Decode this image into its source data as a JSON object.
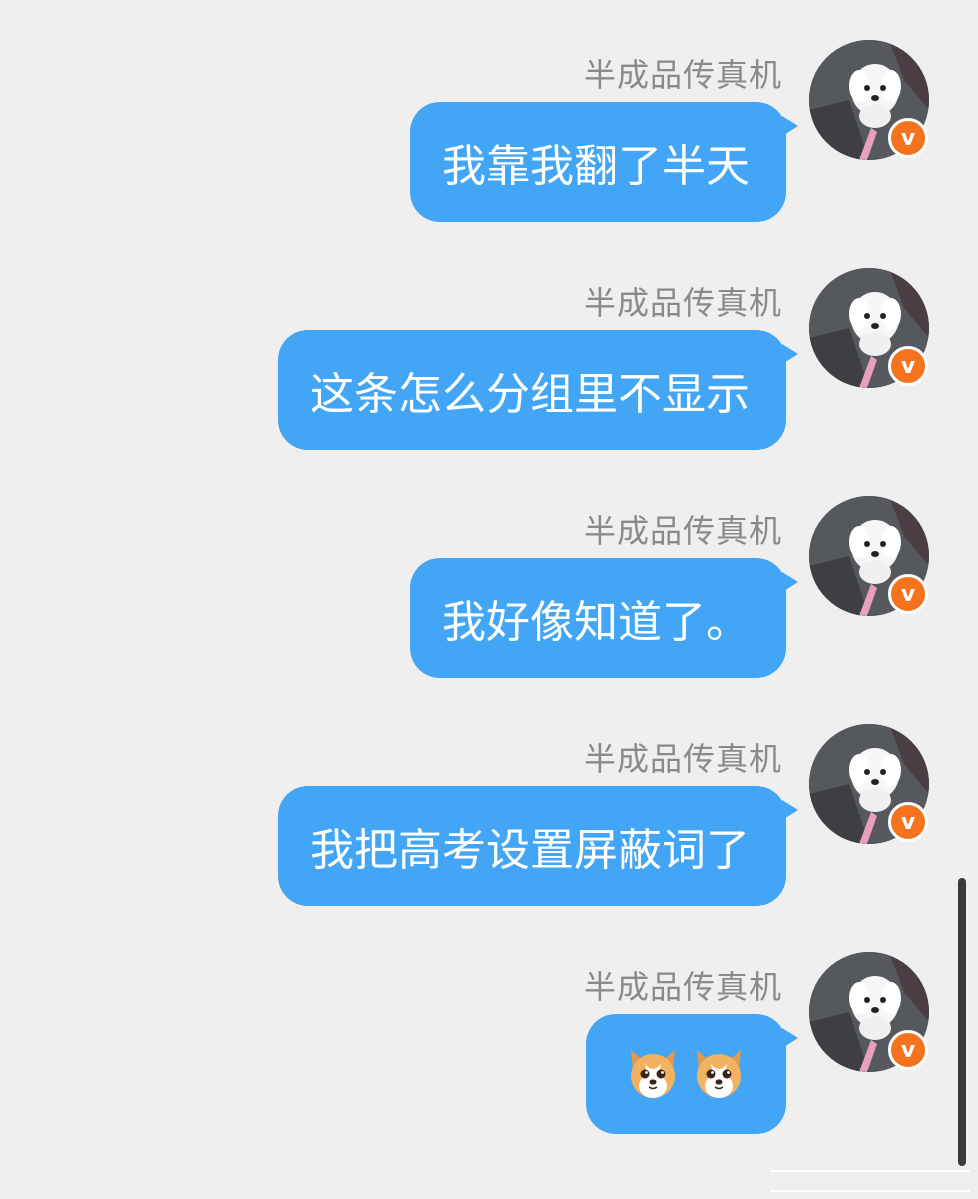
{
  "messages": [
    {
      "sender": "半成品传真机",
      "text": "我靠我翻了半天",
      "badge": "v"
    },
    {
      "sender": "半成品传真机",
      "text": "这条怎么分组里不显示",
      "badge": "v"
    },
    {
      "sender": "半成品传真机",
      "text": "我好像知道了。",
      "badge": "v"
    },
    {
      "sender": "半成品传真机",
      "text": "我把高考设置屏蔽词了",
      "badge": "v"
    },
    {
      "sender": "半成品传真机",
      "emoji": [
        "dog-face-emoji",
        "dog-face-emoji"
      ],
      "badge": "v"
    }
  ],
  "colors": {
    "background": "#efefef",
    "bubble": "#42a5f5",
    "sender_text": "#8a8a8a",
    "badge": "#f5731c"
  }
}
